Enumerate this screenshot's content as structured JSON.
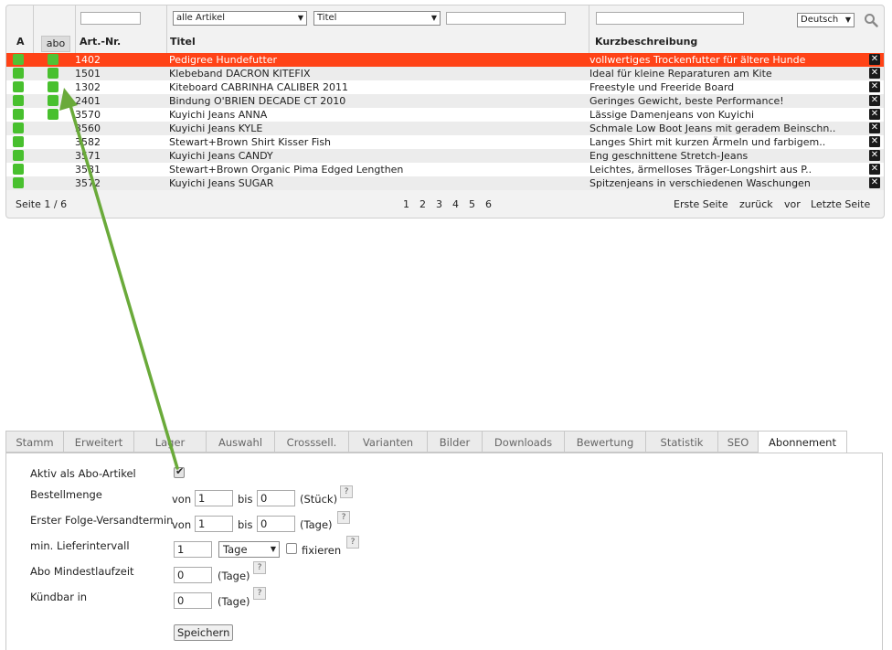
{
  "filters": {
    "article_filter": "alle Artikel",
    "field_select": "Titel",
    "language": "Deutsch"
  },
  "columns": {
    "a": "A",
    "abo": "abo",
    "art_nr": "Art.-Nr.",
    "titel": "Titel",
    "kurzbeschreibung": "Kurzbeschreibung"
  },
  "rows": [
    {
      "art_nr": "1402",
      "abo": true,
      "titel": "Pedigree Hundefutter",
      "beschreibung": "vollwertiges Trockenfutter für ältere Hunde",
      "selected": true
    },
    {
      "art_nr": "1501",
      "abo": true,
      "titel": "Klebeband DACRON KITEFIX",
      "beschreibung": "Ideal für kleine Reparaturen am Kite"
    },
    {
      "art_nr": "1302",
      "abo": true,
      "titel": "Kiteboard CABRINHA CALIBER 2011",
      "beschreibung": "Freestyle und Freeride Board"
    },
    {
      "art_nr": "2401",
      "abo": true,
      "titel": "Bindung O'BRIEN DECADE CT 2010",
      "beschreibung": "Geringes Gewicht, beste Performance!"
    },
    {
      "art_nr": "3570",
      "abo": true,
      "titel": "Kuyichi Jeans ANNA",
      "beschreibung": "Lässige Damenjeans von Kuyichi"
    },
    {
      "art_nr": "3560",
      "abo": false,
      "titel": "Kuyichi Jeans KYLE",
      "beschreibung": "Schmale Low Boot Jeans mit geradem Beinschn.."
    },
    {
      "art_nr": "3582",
      "abo": false,
      "titel": "Stewart+Brown Shirt Kisser Fish",
      "beschreibung": "Langes Shirt mit kurzen Ärmeln und farbigem.."
    },
    {
      "art_nr": "3571",
      "abo": false,
      "titel": "Kuyichi Jeans CANDY",
      "beschreibung": "Eng geschnittene Stretch-Jeans"
    },
    {
      "art_nr": "3581",
      "abo": false,
      "titel": "Stewart+Brown Organic Pima Edged Lengthen",
      "beschreibung": "Leichtes, ärmelloses Träger-Longshirt aus P.."
    },
    {
      "art_nr": "3572",
      "abo": false,
      "titel": "Kuyichi Jeans SUGAR",
      "beschreibung": "Spitzenjeans in verschiedenen Waschungen"
    }
  ],
  "pager": {
    "info": "Seite 1 / 6",
    "pages": [
      "1",
      "2",
      "3",
      "4",
      "5",
      "6"
    ],
    "first": "Erste Seite",
    "back": "zurück",
    "next": "vor",
    "last": "Letzte Seite"
  },
  "tabs": [
    "Stamm",
    "Erweitert",
    "Lager",
    "Auswahl",
    "Crosssell.",
    "Varianten",
    "Bilder",
    "Downloads",
    "Bewertung",
    "Statistik",
    "SEO",
    "Abonnement"
  ],
  "active_tab": "Abonnement",
  "form": {
    "aktiv_label": "Aktiv als Abo-Artikel",
    "aktiv_checked": true,
    "bestellmenge_label": "Bestellmenge",
    "bestellmenge_von": "1",
    "bestellmenge_bis": "0",
    "bestellmenge_unit": "(Stück)",
    "folge_label": "Erster Folge-Versandtermin",
    "folge_von": "1",
    "folge_bis": "0",
    "folge_unit": "(Tage)",
    "intervall_label": "min. Lieferintervall",
    "intervall_value": "1",
    "intervall_unit_select": "Tage",
    "fixieren_label": "fixieren",
    "laufzeit_label": "Abo Mindestlaufzeit",
    "laufzeit_value": "0",
    "laufzeit_unit": "(Tage)",
    "kuendbar_label": "Kündbar in",
    "kuendbar_value": "0",
    "kuendbar_unit": "(Tage)",
    "von": "von",
    "bis": "bis",
    "help": "?",
    "save": "Speichern"
  },
  "colors": {
    "selected_row": "#ff4317",
    "status_green": "#48c02e",
    "arrow": "#6aaa3a"
  }
}
